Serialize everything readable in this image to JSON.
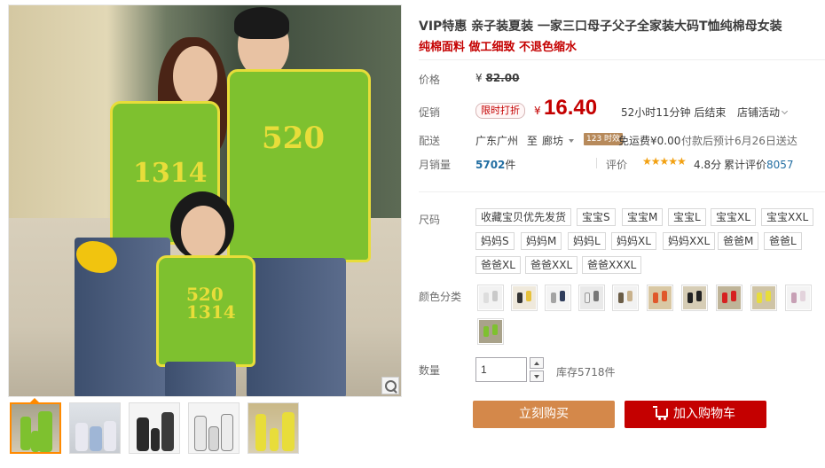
{
  "product": {
    "title": "VIP特惠 亲子装夏装 一家三口母子父子全家装大码T恤纯棉母女装",
    "subtitle": "纯棉面料 做工细致 不退色缩水"
  },
  "gallery": {
    "main_shirt_text_dad": "520",
    "main_shirt_text_mom": "1314",
    "main_shirt_text_kid": "520 1314",
    "zoom_icon": "magnifier-icon"
  },
  "price": {
    "label": "价格",
    "original": "¥ 82.00",
    "original_symbol": "¥",
    "original_value": "82.00"
  },
  "promo": {
    "label": "促销",
    "tag": "限时打折",
    "currency": "¥",
    "price": "16.40",
    "countdown": "52小时11分钟 后结束",
    "store_activity": "店铺活动"
  },
  "shipping": {
    "label": "配送",
    "from": "广东广州",
    "to_word": "至",
    "to_city": "廊坊",
    "badge": "123 时效",
    "free": "免运费¥0.00",
    "note": "付款后预计6月26日送达"
  },
  "sales": {
    "label": "月销量",
    "count": "5702",
    "unit": "件",
    "rating_label": "评价",
    "stars": "★★★★★",
    "score": "4.8分",
    "reviews_prefix": "累计评价",
    "reviews": "8057"
  },
  "sizes": {
    "label": "尺码",
    "options": [
      "收藏宝贝优先发货",
      "宝宝S",
      "宝宝M",
      "宝宝L",
      "宝宝XL",
      "宝宝XXL",
      "妈妈S",
      "妈妈M",
      "妈妈L",
      "妈妈XL",
      "妈妈XXL",
      "爸爸M",
      "爸爸L",
      "爸爸XL",
      "爸爸XXL",
      "爸爸XXXL"
    ]
  },
  "colors": {
    "label": "颜色分类"
  },
  "quantity": {
    "label": "数量",
    "value": "1",
    "stock": "库存5718件"
  },
  "actions": {
    "buy_now": "立刻购买",
    "add_to_cart": "加入购物车"
  },
  "colors_theme": {
    "accent_red": "#c40000",
    "buy_brown": "#d4884a",
    "link_blue": "#226ea2",
    "star_orange": "#f2a112"
  }
}
